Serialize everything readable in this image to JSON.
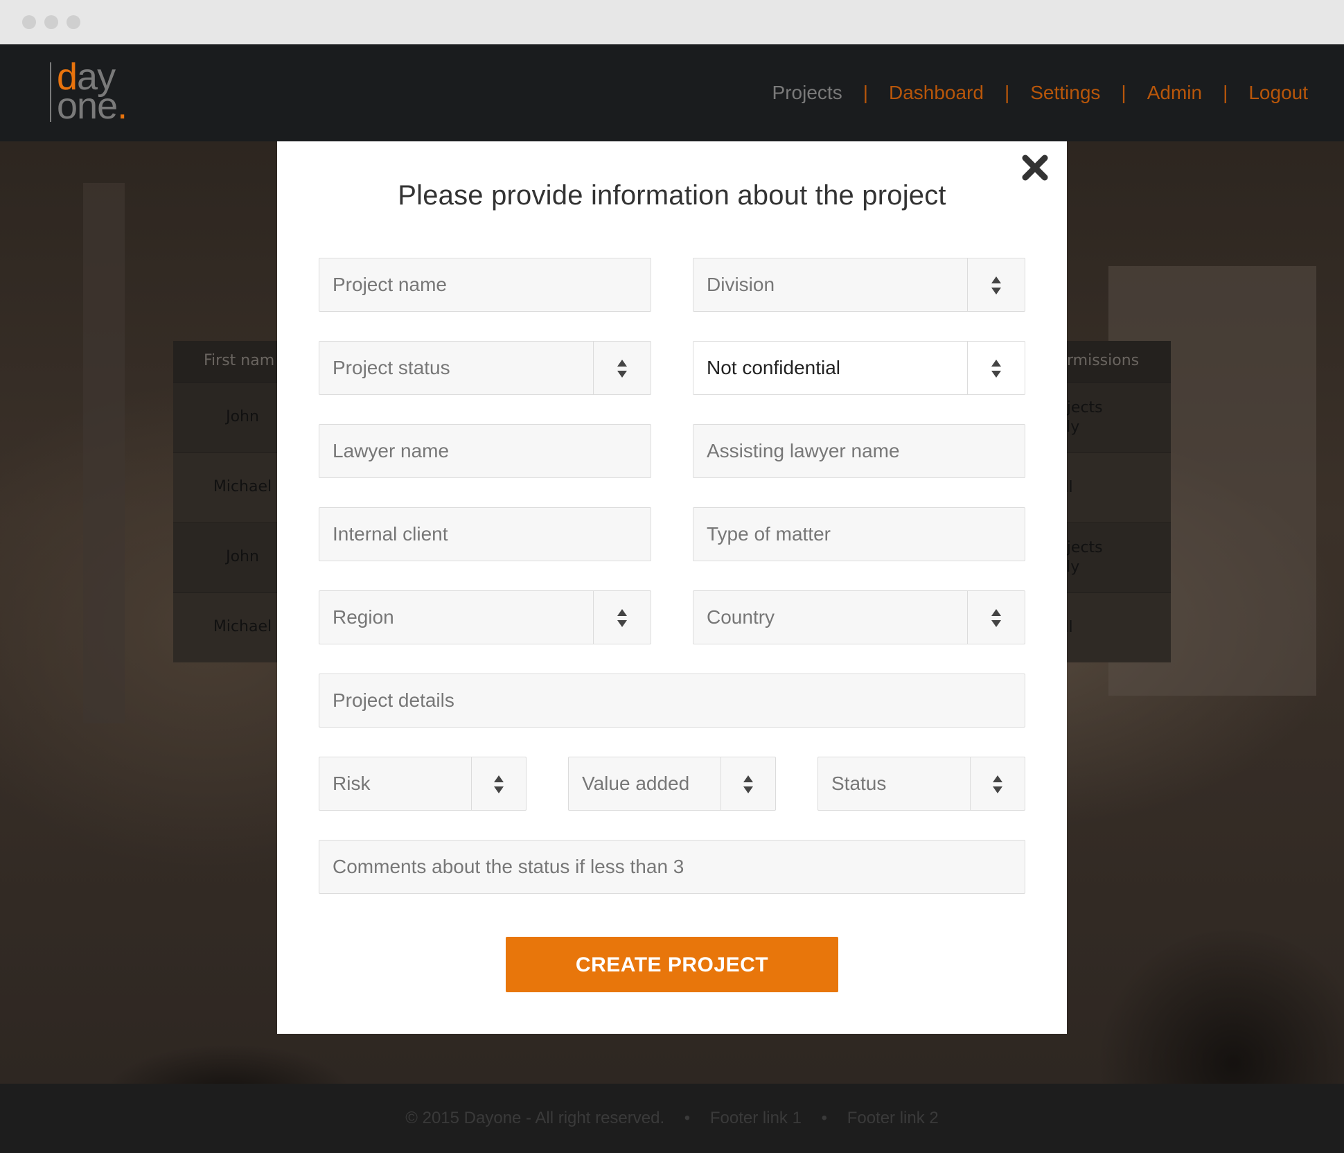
{
  "header": {
    "logo": {
      "line1_accent": "d",
      "line1_rest": "ay",
      "line2": "one",
      "line2_dot": "."
    },
    "nav": [
      "Projects",
      "Dashboard",
      "Settings",
      "Admin",
      "Logout"
    ],
    "separator": "|"
  },
  "background_table": {
    "col1_header": "First nam",
    "col2_header": "rmissions",
    "rows": [
      {
        "first_name": "John",
        "permissions_l1": "’s projects",
        "permissions_l2": "only"
      },
      {
        "first_name": "Michael",
        "permissions_l1": "All",
        "permissions_l2": ""
      },
      {
        "first_name": "John",
        "permissions_l1": "’s projects",
        "permissions_l2": "only"
      },
      {
        "first_name": "Michael",
        "permissions_l1": "All",
        "permissions_l2": ""
      }
    ]
  },
  "footer": {
    "copyright": "© 2015 Dayone - All right reserved.",
    "bullet": "•",
    "link1": "Footer link 1",
    "link2": "Footer link 2"
  },
  "modal": {
    "title": "Please provide information about the project",
    "fields": {
      "project_name": {
        "placeholder": "Project name"
      },
      "division": {
        "placeholder": "Division"
      },
      "project_status": {
        "placeholder": "Project status"
      },
      "confidentiality": {
        "value": "Not confidential"
      },
      "lawyer_name": {
        "placeholder": "Lawyer name"
      },
      "assisting_lawyer_name": {
        "placeholder": "Assisting lawyer name"
      },
      "internal_client": {
        "placeholder": "Internal client"
      },
      "type_of_matter": {
        "placeholder": "Type of matter"
      },
      "region": {
        "placeholder": "Region"
      },
      "country": {
        "placeholder": "Country"
      },
      "project_details": {
        "placeholder": "Project details"
      },
      "risk": {
        "placeholder": "Risk"
      },
      "value_added": {
        "placeholder": "Value added"
      },
      "status": {
        "placeholder": "Status"
      },
      "comments": {
        "placeholder": "Comments about the status if less than 3"
      }
    },
    "submit_label": "CREATE PROJECT"
  },
  "colors": {
    "accent": "#e8760b",
    "title": "#333333",
    "field_bg": "#f7f7f7",
    "field_border": "#dcdcdc"
  },
  "icons": {
    "close": "close-icon",
    "select": "sort-arrows-icon"
  }
}
